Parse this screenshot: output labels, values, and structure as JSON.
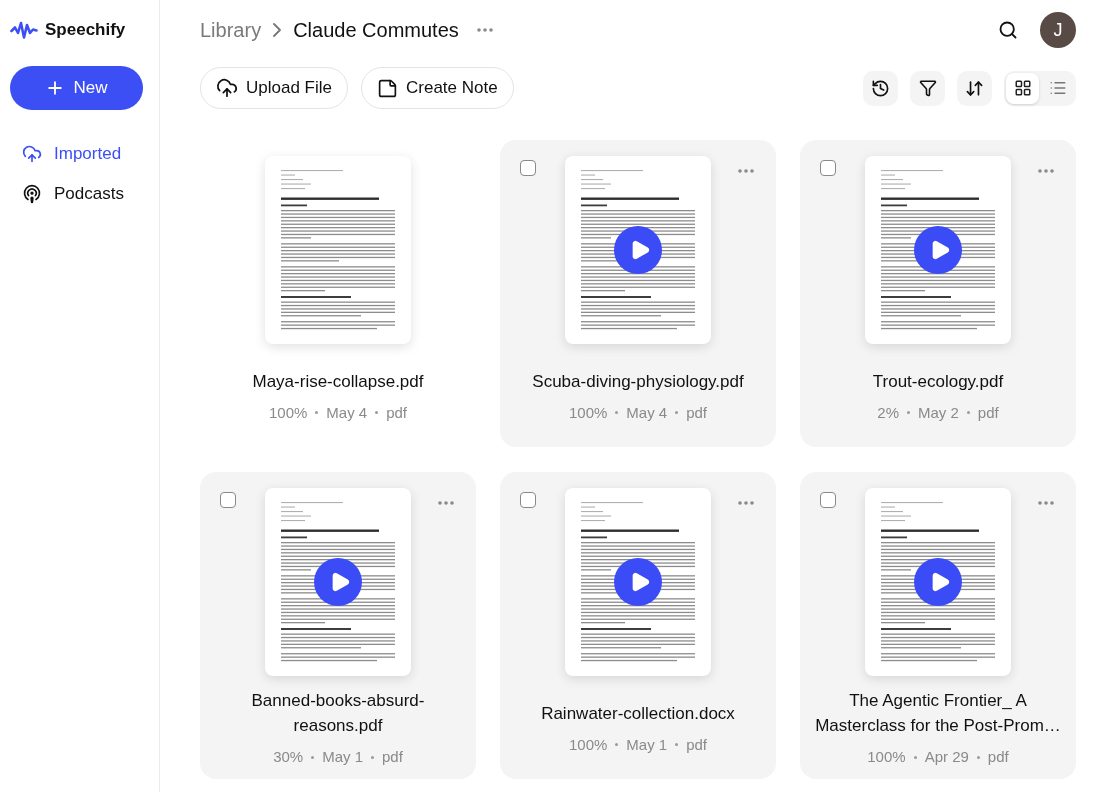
{
  "brand": {
    "name": "Speechify"
  },
  "new_button": {
    "label": "New"
  },
  "sidebar": {
    "items": [
      {
        "label": "Imported",
        "kind": "imported",
        "selected": true
      },
      {
        "label": "Podcasts",
        "kind": "podcasts",
        "selected": false
      }
    ]
  },
  "breadcrumb": [
    "Library",
    "Claude Commutes"
  ],
  "avatar": {
    "initial": "J"
  },
  "actions": [
    {
      "label": "Upload File",
      "kind": "upload"
    },
    {
      "label": "Create Note",
      "kind": "note"
    }
  ],
  "view_modes": [
    {
      "kind": "grid",
      "selected": true
    },
    {
      "kind": "list",
      "selected": false
    }
  ],
  "documents": [
    {
      "title": "Maya-rise-collapse.pdf",
      "progress": "100%",
      "date": "May 4",
      "type": "pdf",
      "highlighted": false,
      "checked": false
    },
    {
      "title": "Scuba-diving-physiology.pdf",
      "progress": "100%",
      "date": "May 4",
      "type": "pdf",
      "highlighted": true,
      "checked": false
    },
    {
      "title": "Trout-ecology.pdf",
      "progress": "2%",
      "date": "May 2",
      "type": "pdf",
      "highlighted": true,
      "checked": false
    },
    {
      "title": "Banned-books-absurd-reasons.pdf",
      "progress": "30%",
      "date": "May 1",
      "type": "pdf",
      "highlighted": true,
      "checked": false
    },
    {
      "title": "Rainwater-collection.docx",
      "progress": "100%",
      "date": "May 1",
      "type": "pdf",
      "highlighted": true,
      "checked": false
    },
    {
      "title": "The Agentic Frontier_ A Masterclass for the Post-Prom…",
      "progress": "100%",
      "date": "Apr 29",
      "type": "pdf",
      "highlighted": true,
      "checked": false
    }
  ]
}
